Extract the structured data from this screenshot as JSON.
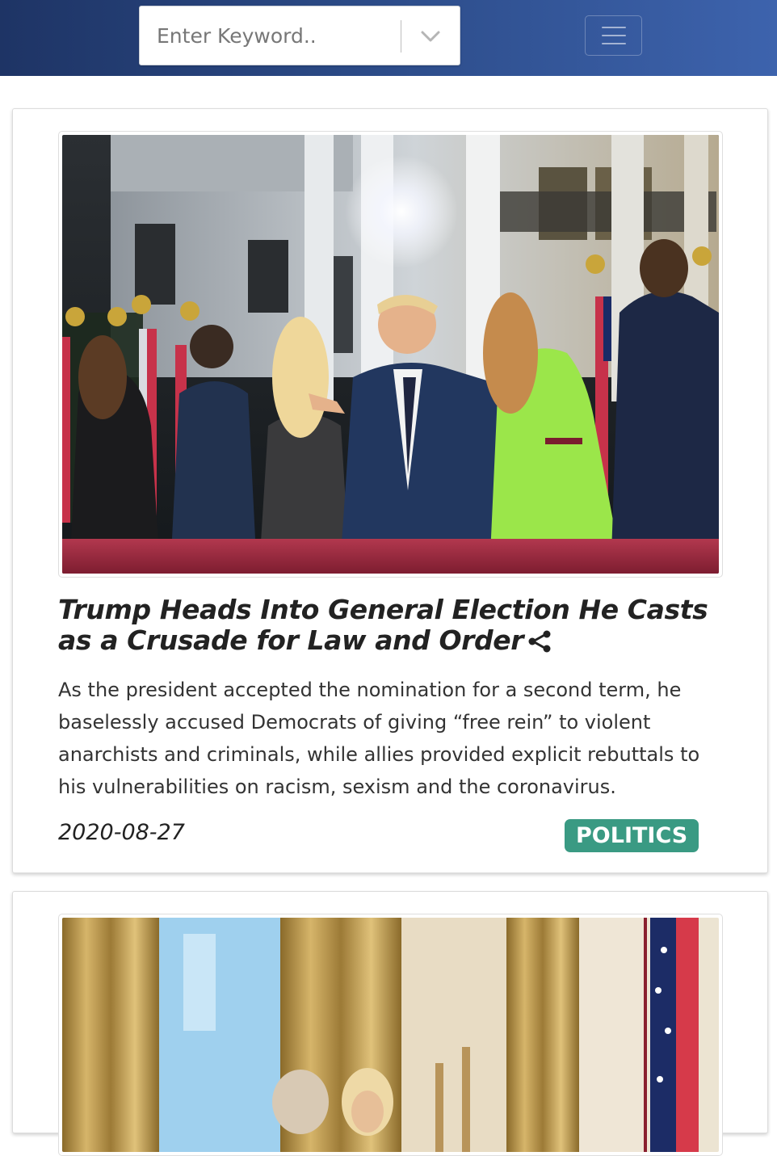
{
  "header": {
    "search": {
      "placeholder": "Enter Keyword..",
      "value": ""
    },
    "dropdown_icon": "chevron-down-icon",
    "menu_icon": "hamburger-menu-icon"
  },
  "articles": [
    {
      "headline": "Trump Heads Into General Election He Casts as a Crusade for Law and Order",
      "summary": "As the president accepted the nomination for a second term, he baselessly accused Democrats of giving “free rein” to violent anarchists and criminals, while allies provided explicit rebuttals to his vulnerabilities on racism, sexism and the coronavirus.",
      "date": "2020-08-27",
      "category": "POLITICS",
      "share_icon": "share-icon"
    },
    {
      "headline": "",
      "summary": "",
      "date": "",
      "category": ""
    }
  ],
  "colors": {
    "header_start": "#1e3465",
    "header_end": "#3d63ad",
    "badge": "#3a9a83",
    "headline_text": "#222222",
    "body_text": "#333333"
  }
}
